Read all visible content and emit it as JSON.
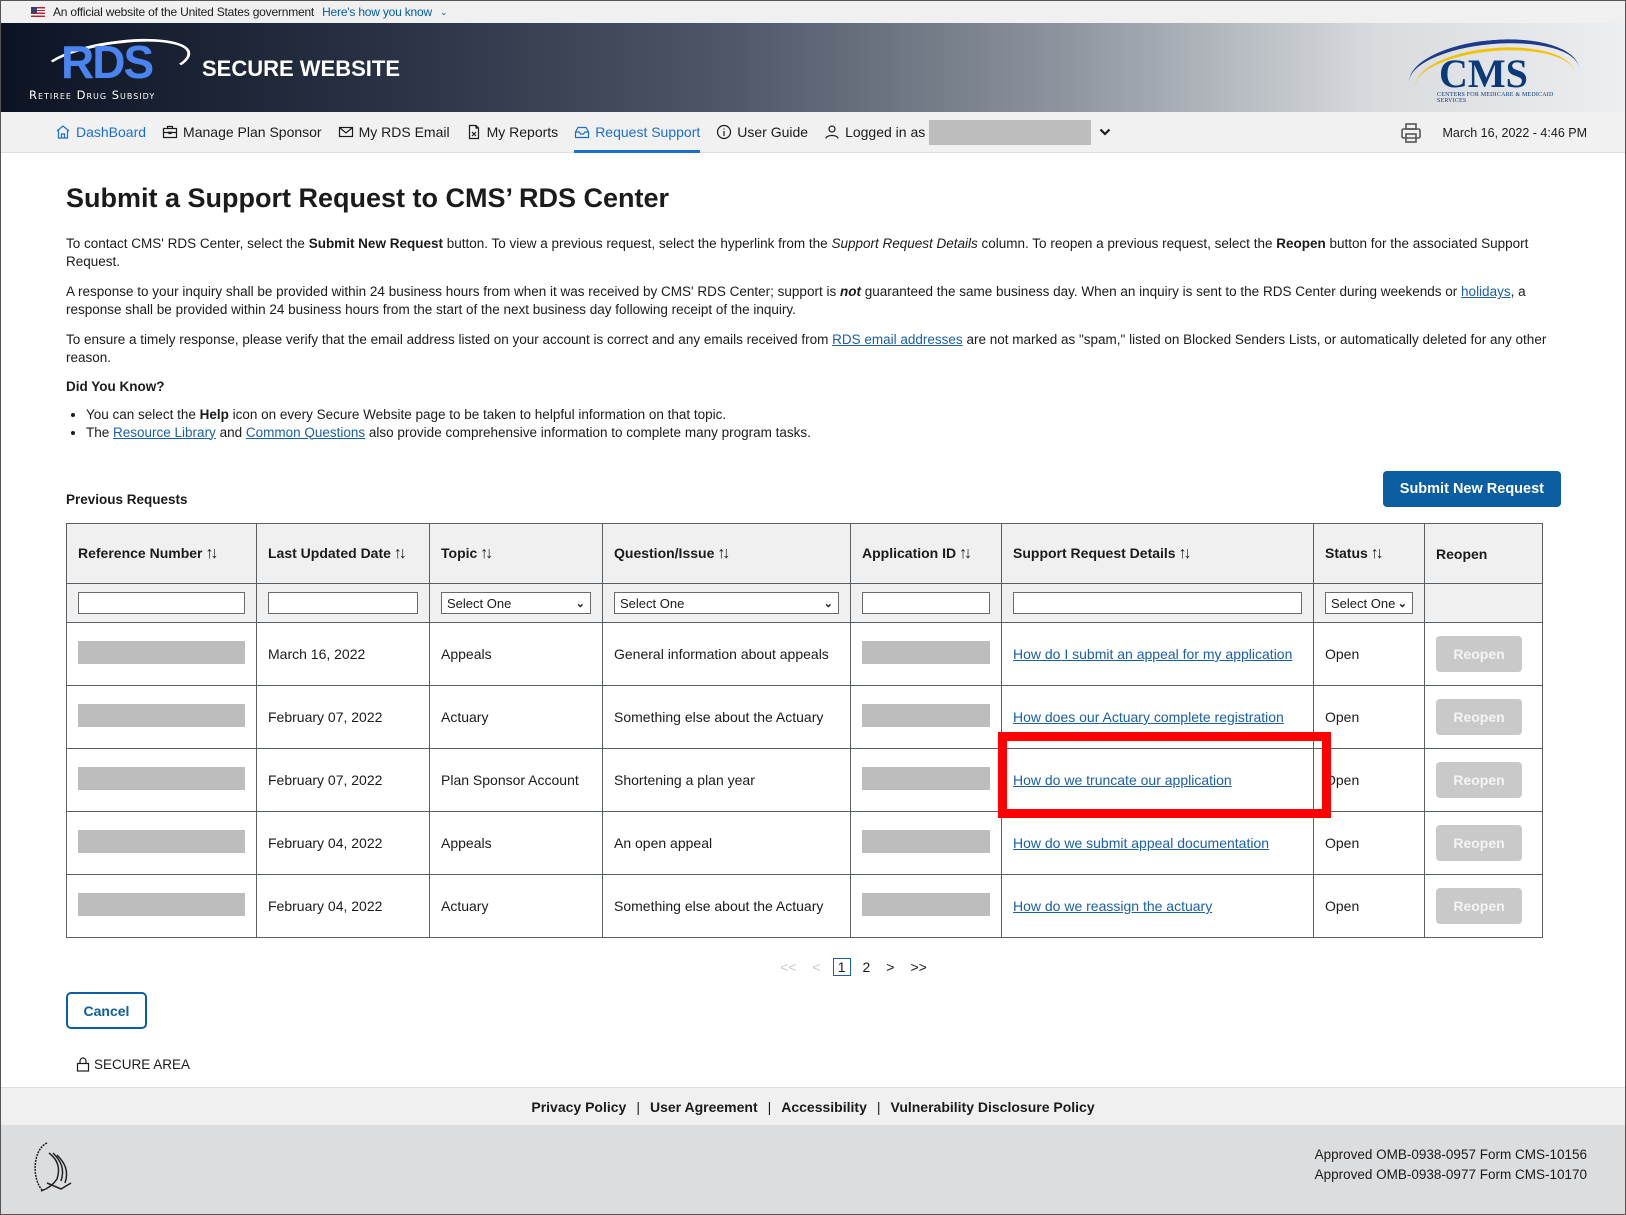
{
  "gov_banner": {
    "text": "An official website of the United States government",
    "link": "Here's how you know"
  },
  "header": {
    "logo_word": "RDS",
    "logo_subtitle": "Retiree Drug Subsidy",
    "site_title": "SECURE WEBSITE",
    "cms_word": "CMS",
    "cms_subtitle": "CENTERS FOR MEDICARE & MEDICAID SERVICES"
  },
  "nav": {
    "items": [
      {
        "label": "DashBoard",
        "icon": "home-icon"
      },
      {
        "label": "Manage Plan Sponsor",
        "icon": "briefcase-icon"
      },
      {
        "label": "My RDS Email",
        "icon": "mail-icon"
      },
      {
        "label": "My Reports",
        "icon": "report-icon"
      },
      {
        "label": "Request Support",
        "icon": "inbox-icon",
        "active": true
      },
      {
        "label": "User Guide",
        "icon": "info-icon"
      }
    ],
    "logged_in_label": "Logged in as",
    "datetime": "March 16, 2022 - 4:46 PM"
  },
  "page": {
    "title": "Submit a Support Request to CMS’ RDS Center",
    "p1": {
      "t1": "To contact CMS' RDS Center, select the ",
      "b1": "Submit New Request",
      "t2": " button. To view a previous request, select the hyperlink from the ",
      "i1": "Support Request Details",
      "t3": " column. To reopen a previous request, select the ",
      "b2": "Reopen",
      "t4": " button for the associated Support Request."
    },
    "p2": {
      "t1": "A response to your inquiry shall be provided within 24 business hours from when it was received by CMS' RDS Center; support is ",
      "bi": "not",
      "t2": " guaranteed the same business day. When an inquiry is sent to the RDS Center during weekends or ",
      "link": "holidays",
      "t3": ", a response shall be provided within 24 business hours from the start of the next business day following receipt of the inquiry."
    },
    "p3": {
      "t1": "To ensure a timely response, please verify that the email address listed on your account is correct and any emails received from ",
      "link": "RDS email addresses",
      "t2": " are not marked as \"spam,\" listed on Blocked Senders Lists, or automatically deleted for any other reason."
    },
    "did_you_know": "Did You Know?",
    "bullet1": {
      "t1": "You can select the ",
      "b": "Help",
      "t2": " icon on every Secure Website page to be taken to helpful information on that topic."
    },
    "bullet2": {
      "t1": "The ",
      "link1": "Resource Library",
      "t2": " and ",
      "link2": "Common Questions",
      "t3": " also provide comprehensive information to complete many program tasks."
    },
    "previous_requests": "Previous Requests",
    "submit_button": "Submit New Request"
  },
  "table": {
    "columns": [
      "Reference Number",
      "Last Updated Date",
      "Topic",
      "Question/Issue",
      "Application ID",
      "Support Request Details",
      "Status",
      "Reopen"
    ],
    "filter_select_default": "Select One",
    "rows": [
      {
        "date": "March 16, 2022",
        "topic": "Appeals",
        "question": "General information about appeals",
        "details": "How do I submit an appeal for my application",
        "status": "Open",
        "reopen": "Reopen"
      },
      {
        "date": "February 07, 2022",
        "topic": "Actuary",
        "question": "Something else about the Actuary",
        "details": "How does our Actuary complete registration",
        "status": "Open",
        "reopen": "Reopen"
      },
      {
        "date": "February 07, 2022",
        "topic": "Plan Sponsor Account",
        "question": "Shortening a plan year",
        "details": "How do we truncate our application",
        "status": "Open",
        "reopen": "Reopen"
      },
      {
        "date": "February 04, 2022",
        "topic": "Appeals",
        "question": "An open appeal",
        "details": "How do we submit appeal documentation",
        "status": "Open",
        "reopen": "Reopen"
      },
      {
        "date": "February 04, 2022",
        "topic": "Actuary",
        "question": "Something else about the Actuary",
        "details": "How do we reassign the actuary",
        "status": "Open",
        "reopen": "Reopen"
      }
    ]
  },
  "pagination": {
    "first": "<<",
    "prev": "<",
    "pages": [
      "1",
      "2"
    ],
    "current": "1",
    "next": ">",
    "last": ">>"
  },
  "cancel_button": "Cancel",
  "secure_area": "SECURE AREA",
  "footer": {
    "links": [
      "Privacy Policy",
      "User Agreement",
      "Accessibility",
      "Vulnerability Disclosure Policy"
    ],
    "omb": [
      "Approved OMB-0938-0957 Form CMS-10156",
      "Approved OMB-0938-0977 Form CMS-10170"
    ]
  },
  "colors": {
    "primary": "#0b5ea2",
    "link": "#1a5fa8",
    "nav_active": "#1a6fd3",
    "highlight": "#ff0000"
  }
}
